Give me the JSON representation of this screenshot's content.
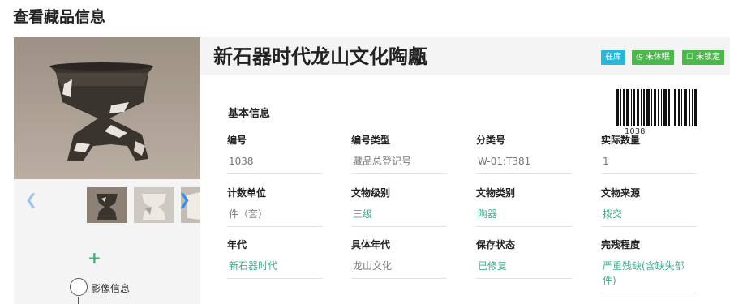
{
  "page": {
    "title": "查看藏品信息"
  },
  "gallery": {
    "image_info_label": "影像信息"
  },
  "item": {
    "title": "新石器时代龙山文化陶甗",
    "tags": {
      "in_stock": "在库",
      "awake": "未休眠",
      "unlocked": "未锁定"
    },
    "barcode_number": "1038"
  },
  "basic_info": {
    "section_title": "基本信息",
    "fields": [
      {
        "label": "编号",
        "value": "1038"
      },
      {
        "label": "编号类型",
        "value": "藏品总登记号"
      },
      {
        "label": "分类号",
        "value": "W-01:T381"
      },
      {
        "label": "实际数量",
        "value": "1"
      },
      {
        "label": "计数单位",
        "value": "件（套）"
      },
      {
        "label": "文物级别",
        "value": "三级"
      },
      {
        "label": "文物类别",
        "value": "陶器"
      },
      {
        "label": "文物来源",
        "value": "拨交"
      },
      {
        "label": "年代",
        "value": "新石器时代"
      },
      {
        "label": "具体年代",
        "value": "龙山文化"
      },
      {
        "label": "保存状态",
        "value": "已修复"
      },
      {
        "label": "完残程度",
        "value": "严重残缺(含缺失部件)"
      }
    ]
  },
  "colors": {
    "accent": "#3fae8f",
    "tag_blue": "#29b6d9",
    "tag_green": "#4cb84c"
  }
}
